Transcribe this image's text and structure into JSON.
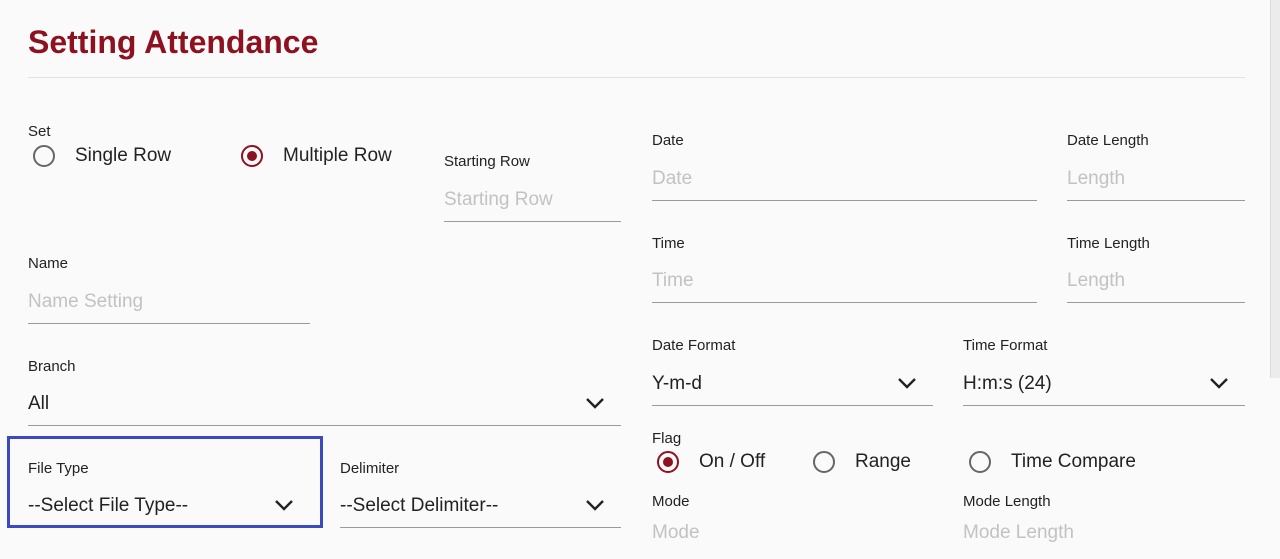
{
  "title": "Setting Attendance",
  "set": {
    "label": "Set",
    "options": [
      {
        "label": "Single Row",
        "selected": false
      },
      {
        "label": "Multiple Row",
        "selected": true
      }
    ]
  },
  "starting_row": {
    "label": "Starting Row",
    "placeholder": "Starting Row"
  },
  "name": {
    "label": "Name",
    "placeholder": "Name Setting"
  },
  "branch": {
    "label": "Branch",
    "value": "All"
  },
  "file_type": {
    "label": "File Type",
    "value": "--Select File Type--"
  },
  "delimiter": {
    "label": "Delimiter",
    "value": "--Select Delimiter--"
  },
  "date": {
    "label": "Date",
    "placeholder": "Date"
  },
  "date_length": {
    "label": "Date Length",
    "placeholder": "Length"
  },
  "time": {
    "label": "Time",
    "placeholder": "Time"
  },
  "time_length": {
    "label": "Time Length",
    "placeholder": "Length"
  },
  "date_format": {
    "label": "Date Format",
    "value": "Y-m-d"
  },
  "time_format": {
    "label": "Time Format",
    "value": "H:m:s (24)"
  },
  "flag": {
    "label": "Flag",
    "options": [
      {
        "label": "On / Off",
        "selected": true
      },
      {
        "label": "Range",
        "selected": false
      },
      {
        "label": "Time Compare",
        "selected": false
      }
    ]
  },
  "mode": {
    "label": "Mode",
    "placeholder": "Mode"
  },
  "mode_length": {
    "label": "Mode Length",
    "placeholder": "Mode Length"
  },
  "colors": {
    "accent": "#8e1120",
    "focus": "#3d49c0"
  },
  "icons": {
    "dropdown": "chevron-down-icon"
  }
}
